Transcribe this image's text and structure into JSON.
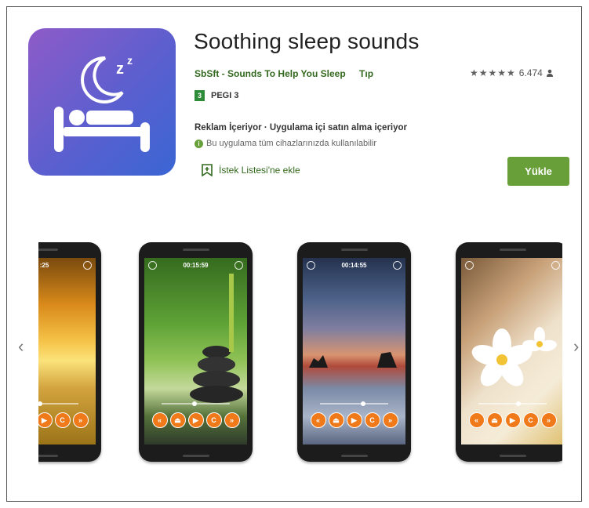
{
  "app": {
    "title": "Soothing sleep sounds",
    "developer": "SbSft - Sounds To Help You Sleep",
    "category": "Tıp",
    "rating_stars": "★★★★★",
    "rating_count": "6.474",
    "pegi": "PEGI 3",
    "pegi_badge": "3",
    "ads_notice": "Reklam İçeriyor · Uygulama içi satın alma içeriyor",
    "compat_notice": "Bu uygulama tüm cihazlarınızda kullanılabilir",
    "wishlist_label": "İstek Listesi'ne ekle",
    "install_label": "Yükle",
    "icon_zz": "Z",
    "accent_color": "#689f38"
  },
  "gallery": {
    "prev_arrow": "‹",
    "next_arrow": "›",
    "screens": [
      {
        "timer": ":25"
      },
      {
        "timer": "00:15:59"
      },
      {
        "timer": "00:14:55"
      },
      {
        "timer": ""
      }
    ],
    "controls": [
      "«",
      "⏏",
      "▶",
      "C",
      "»"
    ]
  }
}
